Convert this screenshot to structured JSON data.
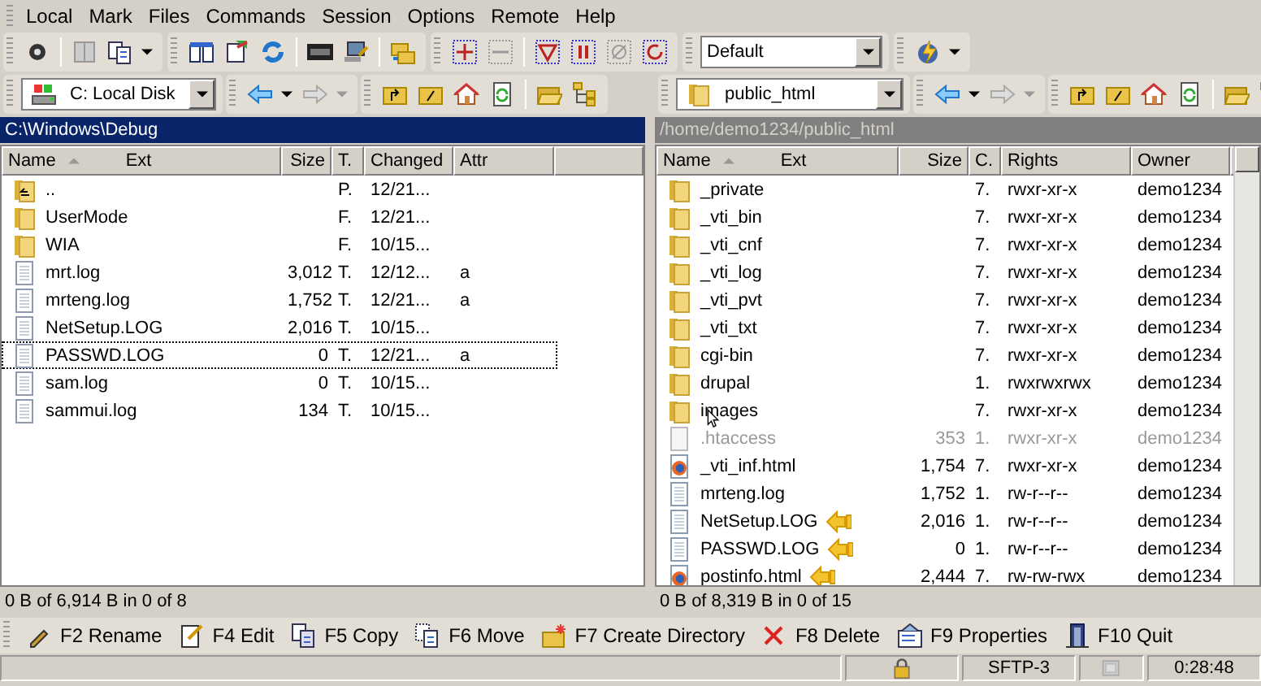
{
  "menu": [
    {
      "label": "Local"
    },
    {
      "label": "Mark"
    },
    {
      "label": "Files"
    },
    {
      "label": "Commands"
    },
    {
      "label": "Session"
    },
    {
      "label": "Options"
    },
    {
      "label": "Remote"
    },
    {
      "label": "Help"
    }
  ],
  "session_combo": {
    "value": "Default"
  },
  "panels": [
    {
      "drive": "C: Local Disk",
      "kind": "disk",
      "path": "C:\\Windows\\Debug",
      "active": true,
      "columns": [
        {
          "label": "Name",
          "ext": "Ext"
        },
        {
          "label": "Size"
        },
        {
          "label": "T."
        },
        {
          "label": "Changed"
        },
        {
          "label": "Attr"
        }
      ],
      "rows": [
        {
          "kind": "parent",
          "cells": [
            "..",
            null,
            "P.",
            "12/21...",
            null
          ],
          "focused": false
        },
        {
          "kind": "folder",
          "cells": [
            "UserMode",
            null,
            "F.",
            "12/21...",
            null
          ],
          "focused": false
        },
        {
          "kind": "folder",
          "cells": [
            "WIA",
            null,
            "F.",
            "10/15...",
            null
          ],
          "focused": false
        },
        {
          "kind": "file",
          "cells": [
            "mrt.log",
            "3,012",
            "T.",
            "12/12...",
            "a"
          ],
          "focused": false
        },
        {
          "kind": "file",
          "cells": [
            "mrteng.log",
            "1,752",
            "T.",
            "12/21...",
            "a"
          ],
          "focused": false
        },
        {
          "kind": "file",
          "cells": [
            "NetSetup.LOG",
            "2,016",
            "T.",
            "10/15...",
            null
          ],
          "focused": false
        },
        {
          "kind": "file",
          "cells": [
            "PASSWD.LOG",
            "0",
            "T.",
            "12/21...",
            "a"
          ],
          "focused": true
        },
        {
          "kind": "file",
          "cells": [
            "sam.log",
            "0",
            "T.",
            "10/15...",
            null
          ],
          "focused": false
        },
        {
          "kind": "file",
          "cells": [
            "sammui.log",
            "134",
            "T.",
            "10/15...",
            null
          ],
          "focused": false
        }
      ],
      "status": "0 B of 6,914 B in 0 of 8"
    },
    {
      "drive": "public_html",
      "kind": "folder",
      "path": "/home/demo1234/public_html",
      "active": false,
      "columns": [
        {
          "label": "Name",
          "ext": "Ext"
        },
        {
          "label": "Size"
        },
        {
          "label": "C."
        },
        {
          "label": "Rights"
        },
        {
          "label": "Owner"
        }
      ],
      "rows": [
        {
          "kind": "folder",
          "cells": [
            "_private",
            null,
            "7.",
            "rwxr-xr-x",
            "demo1234"
          ]
        },
        {
          "kind": "folder",
          "cells": [
            "_vti_bin",
            null,
            "7.",
            "rwxr-xr-x",
            "demo1234"
          ]
        },
        {
          "kind": "folder",
          "cells": [
            "_vti_cnf",
            null,
            "7.",
            "rwxr-xr-x",
            "demo1234"
          ]
        },
        {
          "kind": "folder",
          "cells": [
            "_vti_log",
            null,
            "7.",
            "rwxr-xr-x",
            "demo1234"
          ]
        },
        {
          "kind": "folder",
          "cells": [
            "_vti_pvt",
            null,
            "7.",
            "rwxr-xr-x",
            "demo1234"
          ]
        },
        {
          "kind": "folder",
          "cells": [
            "_vti_txt",
            null,
            "7.",
            "rwxr-xr-x",
            "demo1234"
          ]
        },
        {
          "kind": "folder",
          "cells": [
            "cgi-bin",
            null,
            "7.",
            "rwxr-xr-x",
            "demo1234"
          ]
        },
        {
          "kind": "folder",
          "cells": [
            "drupal",
            null,
            "1.",
            "rwxrwxrwx",
            "demo1234"
          ]
        },
        {
          "kind": "folder",
          "cells": [
            "images",
            null,
            "7.",
            "rwxr-xr-x",
            "demo1234"
          ],
          "pointer": true
        },
        {
          "kind": "file",
          "cells": [
            ".htaccess",
            "353",
            "1.",
            "rwxr-xr-x",
            "demo1234"
          ],
          "hidden": true
        },
        {
          "kind": "html",
          "cells": [
            "_vti_inf.html",
            "1,754",
            "7.",
            "rwxr-xr-x",
            "demo1234"
          ]
        },
        {
          "kind": "file",
          "cells": [
            "mrteng.log",
            "1,752",
            "1.",
            "rw-r--r--",
            "demo1234"
          ]
        },
        {
          "kind": "file",
          "cells": [
            "NetSetup.LOG",
            "2,016",
            "1.",
            "rw-r--r--",
            "demo1234"
          ],
          "flagged": true
        },
        {
          "kind": "file",
          "cells": [
            "PASSWD.LOG",
            "0",
            "1.",
            "rw-r--r--",
            "demo1234"
          ],
          "flagged": true
        },
        {
          "kind": "html",
          "cells": [
            "postinfo.html",
            "2,444",
            "7.",
            "rw-rw-rwx",
            "demo1234"
          ],
          "flagged": true
        }
      ],
      "status": "0 B of 8,319 B in 0 of 15"
    }
  ],
  "commands": [
    {
      "label": "F2 Rename",
      "kind": "rename"
    },
    {
      "label": "F4 Edit",
      "kind": "edit"
    },
    {
      "label": "F5 Copy",
      "kind": "copy"
    },
    {
      "label": "F6 Move",
      "kind": "move"
    },
    {
      "label": "F7 Create Directory",
      "kind": "mkdir"
    },
    {
      "label": "F8 Delete",
      "kind": "delete"
    },
    {
      "label": "F9 Properties",
      "kind": "properties"
    },
    {
      "label": "F10 Quit",
      "kind": "quit"
    }
  ],
  "status_bar": [
    {
      "kind": "lock"
    },
    {
      "kind": "text",
      "label": "SFTP-3"
    },
    {
      "kind": "disabled"
    },
    {
      "kind": "text",
      "label": "0:28:48"
    }
  ]
}
